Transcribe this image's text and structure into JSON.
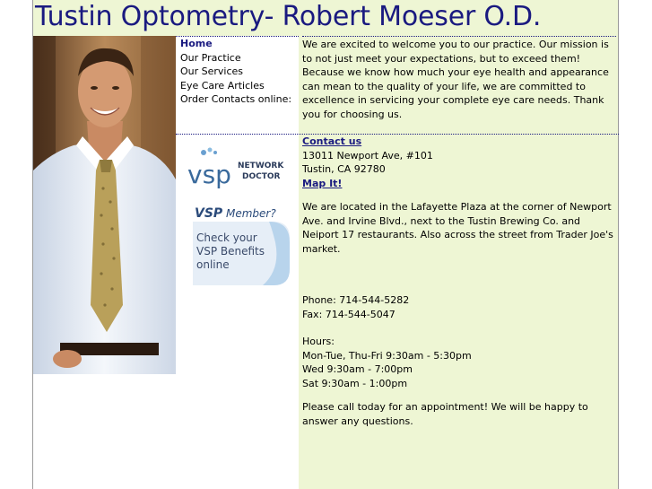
{
  "header": {
    "title": "Tustin Optometry- Robert Moeser O.D."
  },
  "nav": {
    "items": [
      "Home",
      "Our Practice",
      "Our Services",
      "Eye Care Articles",
      "Order Contacts online:"
    ]
  },
  "welcome": {
    "text": "We are excited to welcome you to our practice. Our mission is to not just meet your expectations, but to exceed them! Because we know how much your eye health and appearance can mean to the quality of your life, we are committed to excellence in servicing your complete eye care needs. Thank you for choosing us."
  },
  "contact": {
    "heading": "Contact us",
    "address1": "13011 Newport Ave, #101",
    "address2": "Tustin, CA 92780",
    "map_link": "Map It!",
    "location": "We are located in the Lafayette Plaza at the corner of Newport Ave. and Irvine Blvd., next to the Tustin Brewing Co. and Neiport 17 restaurants. Also across the street from Trader Joe's market.",
    "phone": "Phone: 714-544-5282",
    "fax": "Fax: 714-544-5047",
    "hours_label": "Hours:",
    "hours": [
      "Mon-Tue, Thu-Fri 9:30am - 5:30pm",
      "Wed 9:30am - 7:00pm",
      "Sat 9:30am - 1:00pm"
    ],
    "cta": "Please call today for an appointment! We will be happy to answer any questions."
  },
  "vsp": {
    "logo_text": "vsp",
    "network_line1": "NETWORK",
    "network_line2": "DOCTOR",
    "member_title": "VSP",
    "member_suffix": "Member?",
    "benefits_line1": "Check your",
    "benefits_line2": "VSP Benefits",
    "benefits_line3": "online"
  },
  "colors": {
    "accent": "#1a1a80",
    "panel": "#eef6d4",
    "vsp_blue": "#3a6a9c"
  }
}
